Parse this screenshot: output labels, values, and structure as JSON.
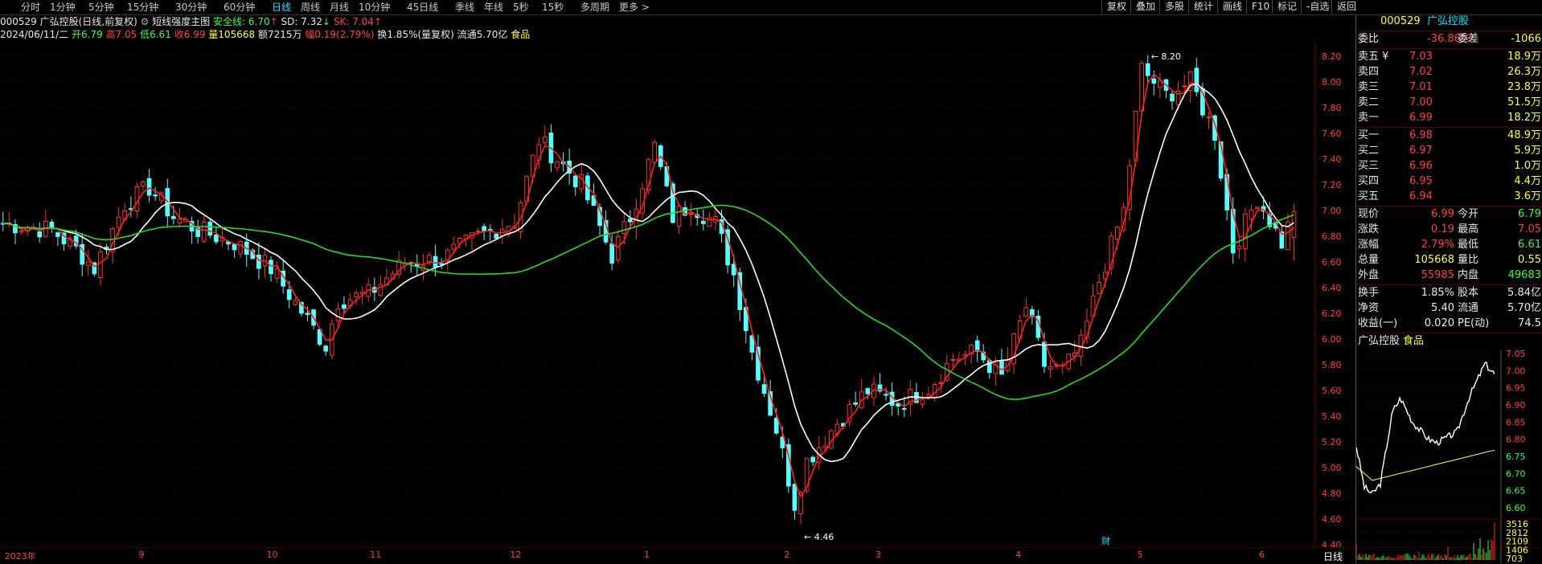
{
  "toolbar": {
    "periods": [
      "分时",
      "1分钟",
      "5分钟",
      "15分钟",
      "30分钟",
      "60分钟",
      "日线",
      "周线",
      "月线",
      "10分钟",
      "45日线",
      "季线",
      "年线",
      "5秒",
      "15秒",
      "多周期",
      "更多 >"
    ],
    "active_index": 6,
    "right_buttons": [
      "复权",
      "叠加",
      "多股",
      "统计",
      "画线",
      "F10",
      "标记",
      "-自选",
      "返回"
    ]
  },
  "info": {
    "code_name": "000529 广弘控股(日线,前复权)",
    "indicator": "短线强度主图",
    "safe_label": "安全线: 6.70",
    "sd_label": "SD: 7.32",
    "sk_label": "SK: 7.04",
    "date": "2024/06/11/二",
    "open": "开6.79",
    "high": "高7.05",
    "low": "低6.61",
    "close": "收6.99",
    "vol": "量105668",
    "amount": "额7215万",
    "change": "幅0.19(2.79%)",
    "turnover": "换1.85%(量复权)",
    "float": "流通5.70亿",
    "sector": "食品"
  },
  "axis": {
    "y_labels": [
      "8.20",
      "8.00",
      "7.80",
      "7.60",
      "7.40",
      "7.20",
      "7.00",
      "6.80",
      "6.60",
      "6.40",
      "6.20",
      "6.00",
      "5.80",
      "5.60",
      "5.40",
      "5.20",
      "5.00",
      "4.80",
      "4.60",
      "4.40"
    ],
    "x_labels": [
      {
        "t": "2023年",
        "i": 0
      },
      {
        "t": "9",
        "i": 22
      },
      {
        "t": "10",
        "i": 43
      },
      {
        "t": "11",
        "i": 60
      },
      {
        "t": "12",
        "i": 83
      },
      {
        "t": "1",
        "i": 105
      },
      {
        "t": "2",
        "i": 128
      },
      {
        "t": "3",
        "i": 143
      },
      {
        "t": "4",
        "i": 166
      },
      {
        "t": "5",
        "i": 186
      },
      {
        "t": "6",
        "i": 206
      }
    ],
    "max_label": "8.20",
    "min_label": "4.46",
    "cai": "财",
    "bottom_right": "日线"
  },
  "chart_data": {
    "type": "candlestick",
    "ylim": [
      4.38,
      8.32
    ],
    "start_price": 6.9,
    "waypoints": [
      [
        0,
        6.9
      ],
      [
        8,
        6.85
      ],
      [
        12,
        6.7
      ],
      [
        15,
        6.55
      ],
      [
        20,
        7.05
      ],
      [
        24,
        7.18
      ],
      [
        28,
        6.95
      ],
      [
        32,
        6.85
      ],
      [
        38,
        6.75
      ],
      [
        44,
        6.55
      ],
      [
        50,
        6.15
      ],
      [
        53,
        5.95
      ],
      [
        55,
        6.3
      ],
      [
        60,
        6.35
      ],
      [
        66,
        6.6
      ],
      [
        72,
        6.62
      ],
      [
        78,
        6.8
      ],
      [
        84,
        6.92
      ],
      [
        88,
        7.55
      ],
      [
        92,
        7.35
      ],
      [
        95,
        7.2
      ],
      [
        100,
        6.65
      ],
      [
        103,
        6.95
      ],
      [
        107,
        7.5
      ],
      [
        110,
        6.95
      ],
      [
        113,
        7.05
      ],
      [
        117,
        6.9
      ],
      [
        120,
        6.5
      ],
      [
        123,
        5.9
      ],
      [
        127,
        5.3
      ],
      [
        130,
        4.72
      ],
      [
        132,
        5.05
      ],
      [
        137,
        5.35
      ],
      [
        142,
        5.6
      ],
      [
        147,
        5.5
      ],
      [
        152,
        5.62
      ],
      [
        156,
        5.85
      ],
      [
        160,
        5.9
      ],
      [
        164,
        5.7
      ],
      [
        168,
        6.25
      ],
      [
        171,
        5.8
      ],
      [
        174,
        5.75
      ],
      [
        177,
        5.95
      ],
      [
        180,
        6.45
      ],
      [
        184,
        7.0
      ],
      [
        187,
        8.1
      ],
      [
        191,
        7.9
      ],
      [
        195,
        8.0
      ],
      [
        199,
        7.6
      ],
      [
        202,
        6.7
      ],
      [
        206,
        7.1
      ],
      [
        210,
        6.75
      ],
      [
        212,
        6.99
      ]
    ]
  },
  "panel": {
    "title_code": "000529",
    "title_name": "广弘控股",
    "weibi_label": "委比",
    "weibi": "-36.86%",
    "weicha_label": "委差",
    "weicha": "-1066",
    "asks": [
      {
        "l": "卖五 ¥",
        "p": "7.03",
        "v": "18.9万"
      },
      {
        "l": "卖四",
        "p": "7.02",
        "v": "26.3万"
      },
      {
        "l": "卖三",
        "p": "7.01",
        "v": "23.8万"
      },
      {
        "l": "卖二",
        "p": "7.00",
        "v": "51.5万"
      },
      {
        "l": "卖一",
        "p": "6.99",
        "v": "18.2万"
      }
    ],
    "bids": [
      {
        "l": "买一",
        "p": "6.98",
        "v": "48.9万"
      },
      {
        "l": "买二",
        "p": "6.97",
        "v": "5.9万"
      },
      {
        "l": "买三",
        "p": "6.96",
        "v": "1.0万"
      },
      {
        "l": "买四",
        "p": "6.95",
        "v": "4.4万"
      },
      {
        "l": "买五",
        "p": "6.94",
        "v": "3.6万"
      }
    ],
    "quote": [
      {
        "l1": "现价",
        "v1": "6.99",
        "c1": "red",
        "l2": "今开",
        "v2": "6.79",
        "c2": "green"
      },
      {
        "l1": "涨跌",
        "v1": "0.19",
        "c1": "red",
        "l2": "最高",
        "v2": "7.05",
        "c2": "red"
      },
      {
        "l1": "涨幅",
        "v1": "2.79%",
        "c1": "red",
        "l2": "最低",
        "v2": "6.61",
        "c2": "green"
      },
      {
        "l1": "总量",
        "v1": "105668",
        "c1": "yel",
        "l2": "量比",
        "v2": "0.55",
        "c2": "yel"
      },
      {
        "l1": "外盘",
        "v1": "55985",
        "c1": "red",
        "l2": "内盘",
        "v2": "49683",
        "c2": "green"
      }
    ],
    "fund": [
      {
        "l1": "换手",
        "v1": "1.85%",
        "l2": "股本",
        "v2": "5.84亿"
      },
      {
        "l1": "净资",
        "v1": "5.40",
        "l2": "流通",
        "v2": "5.70亿"
      },
      {
        "l1": "收益(一)",
        "v1": "0.020",
        "l2": "PE(动)",
        "v2": "74.5"
      }
    ],
    "mini_title": "广弘控股",
    "mini_sector": "食品",
    "mini_prices": [
      "7.05",
      "7.00",
      "6.95",
      "6.90",
      "6.85",
      "6.80",
      "6.75",
      "6.70",
      "6.65",
      "6.60"
    ],
    "mini_vols": [
      "3516",
      "2812",
      "2109",
      "1406",
      "703"
    ]
  }
}
